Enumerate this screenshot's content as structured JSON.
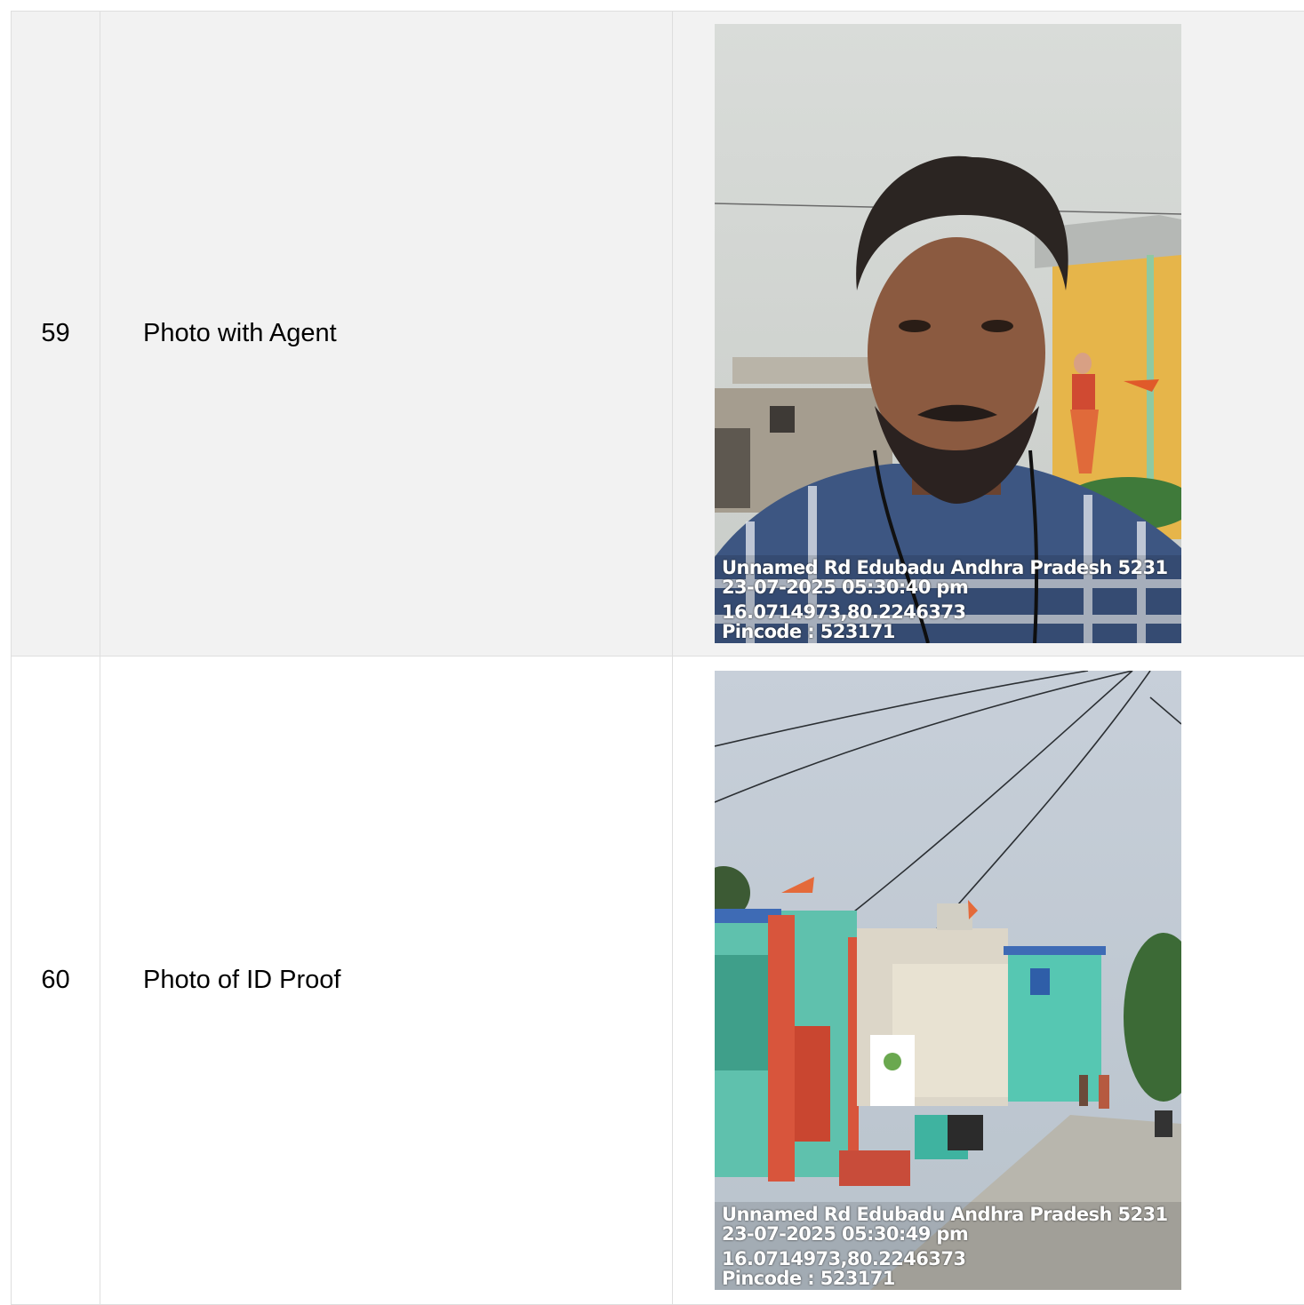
{
  "rows": [
    {
      "number": "59",
      "label": "Photo with Agent",
      "photo": {
        "subject": "selfie-man-checked-shirt",
        "address": "Unnamed Rd Edubadu Andhra Pradesh 5231",
        "datetime": "23-07-2025 05:30:40 pm",
        "coords": "16.0714973,80.2246373",
        "pincode": "Pincode : 523171"
      }
    },
    {
      "number": "60",
      "label": "Photo of ID Proof",
      "photo": {
        "subject": "village-street-houses",
        "address": "Unnamed Rd Edubadu Andhra Pradesh 5231",
        "datetime": "23-07-2025 05:30:49 pm",
        "coords": "16.0714973,80.2246373",
        "pincode": "Pincode : 523171"
      }
    }
  ]
}
